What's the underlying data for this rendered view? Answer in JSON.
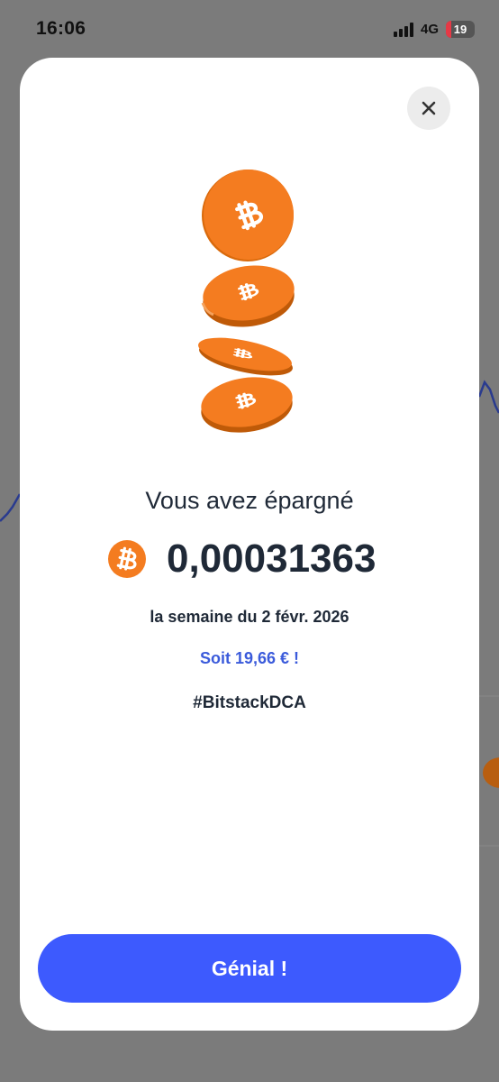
{
  "status_bar": {
    "time": "16:06",
    "network": "4G",
    "battery_level": "19"
  },
  "modal": {
    "close_icon": "close-icon",
    "illustration": "bitcoin-coins-falling",
    "headline": "Vous avez épargné",
    "amount": "0,00031363",
    "amount_icon": "bitcoin-icon",
    "period": "la semaine du 2 févr. 2026",
    "equivalent": "Soit 19,66 € !",
    "hashtag": "#BitstackDCA",
    "primary_button_label": "Génial !"
  },
  "colors": {
    "accent": "#3d5afe",
    "bitcoin_orange": "#f7931a",
    "link_blue": "#3b5bdb",
    "text_dark": "#1f2937"
  }
}
